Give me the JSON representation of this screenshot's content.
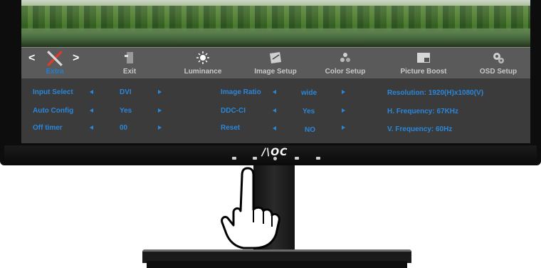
{
  "osd": {
    "tabs": [
      {
        "label": "Extra",
        "icon": "tools-icon",
        "active": true
      },
      {
        "label": "Exit",
        "icon": "exit-door-icon"
      },
      {
        "label": "Luminance",
        "icon": "sun-icon"
      },
      {
        "label": "Image Setup",
        "icon": "image-setup-icon"
      },
      {
        "label": "Color Setup",
        "icon": "color-dots-icon"
      },
      {
        "label": "Picture Boost",
        "icon": "picture-boost-icon"
      },
      {
        "label": "OSD Setup",
        "icon": "osd-setup-icon"
      }
    ],
    "nav_left": "<",
    "nav_right": ">",
    "left_settings": [
      {
        "label": "Input Select",
        "value": "DVI"
      },
      {
        "label": "Auto Config",
        "value": "Yes"
      },
      {
        "label": "Off timer",
        "value": "00"
      }
    ],
    "middle_settings": [
      {
        "label": "Image Ratio",
        "value": "wide"
      },
      {
        "label": "DDC-CI",
        "value": "Yes"
      },
      {
        "label": "Reset",
        "value": "NO"
      }
    ],
    "info": [
      "Resolution:  1920(H)x1080(V)",
      "H. Frequency:  67KHz",
      "V. Frequency:  60Hz"
    ]
  },
  "brand": "/\\OC",
  "colors": {
    "accent": "#2a86d8",
    "menubar": "#5a5a5a",
    "content_bg": "#3b3b3b",
    "bezel": "#0d0d0d"
  }
}
